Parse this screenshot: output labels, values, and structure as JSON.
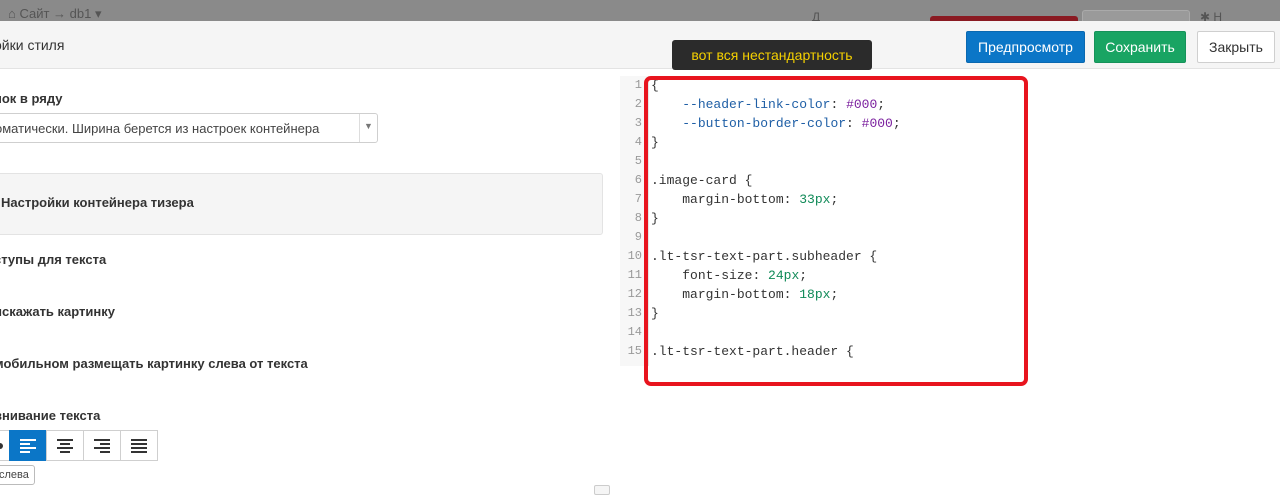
{
  "topbar": {
    "crumb": "⌂ Сайт → db1 ▾",
    "mid_text": "Д",
    "right_text": "✱ Н"
  },
  "modal": {
    "title": "ойки стиля",
    "buttons": {
      "preview": "Предпросмотр",
      "save": "Сохранить",
      "close": "Закрыть"
    }
  },
  "tooltip": "вот вся нестандартность",
  "settings": {
    "per_row_label": "нок в ряду",
    "per_row_value": "оматически. Ширина берется из настроек контейнера",
    "teaser_container_label": "Настройки контейнера тизера",
    "text_padding_label": "ступы для текста",
    "no_distort_label": "искажать картинку",
    "mobile_image_label": "мобильном размещать картинку слева от текста",
    "text_align_label": "внивание текста",
    "align_tooltip": "слева"
  },
  "colors": {
    "preview_button": "#0b76c7",
    "save_button": "#19a463",
    "highlight": "#e8141e",
    "tooltip_text": "#f4d000"
  },
  "code": {
    "lines": [
      {
        "n": "1",
        "parts": [
          {
            "t": "{",
            "c": "sel"
          }
        ]
      },
      {
        "n": "2",
        "parts": [
          {
            "t": "    ",
            "c": "sel"
          },
          {
            "t": "--header-link-color",
            "c": "prop"
          },
          {
            "t": ": ",
            "c": "sel"
          },
          {
            "t": "#000",
            "c": "kw"
          },
          {
            "t": ";",
            "c": "sel"
          }
        ]
      },
      {
        "n": "3",
        "parts": [
          {
            "t": "    ",
            "c": "sel"
          },
          {
            "t": "--button-border-color",
            "c": "prop"
          },
          {
            "t": ": ",
            "c": "sel"
          },
          {
            "t": "#000",
            "c": "kw"
          },
          {
            "t": ";",
            "c": "sel"
          }
        ]
      },
      {
        "n": "4",
        "parts": [
          {
            "t": "}",
            "c": "sel"
          }
        ]
      },
      {
        "n": "5",
        "parts": []
      },
      {
        "n": "6",
        "parts": [
          {
            "t": ".image-card {",
            "c": "sel"
          }
        ]
      },
      {
        "n": "7",
        "parts": [
          {
            "t": "    ",
            "c": "sel"
          },
          {
            "t": "margin-bottom",
            "c": "sel"
          },
          {
            "t": ": ",
            "c": "sel"
          },
          {
            "t": "33px",
            "c": "num"
          },
          {
            "t": ";",
            "c": "sel"
          }
        ]
      },
      {
        "n": "8",
        "parts": [
          {
            "t": "}",
            "c": "sel"
          }
        ]
      },
      {
        "n": "9",
        "parts": []
      },
      {
        "n": "10",
        "parts": [
          {
            "t": ".lt-tsr-text-part.subheader {",
            "c": "sel"
          }
        ]
      },
      {
        "n": "11",
        "parts": [
          {
            "t": "    ",
            "c": "sel"
          },
          {
            "t": "font-size",
            "c": "sel"
          },
          {
            "t": ": ",
            "c": "sel"
          },
          {
            "t": "24px",
            "c": "num"
          },
          {
            "t": ";",
            "c": "sel"
          }
        ]
      },
      {
        "n": "12",
        "parts": [
          {
            "t": "    ",
            "c": "sel"
          },
          {
            "t": "margin-bottom",
            "c": "sel"
          },
          {
            "t": ": ",
            "c": "sel"
          },
          {
            "t": "18px",
            "c": "num"
          },
          {
            "t": ";",
            "c": "sel"
          }
        ]
      },
      {
        "n": "13",
        "parts": [
          {
            "t": "}",
            "c": "sel"
          }
        ]
      },
      {
        "n": "14",
        "parts": []
      },
      {
        "n": "15",
        "parts": [
          {
            "t": ".lt-tsr-text-part.header {",
            "c": "sel"
          }
        ]
      }
    ]
  }
}
